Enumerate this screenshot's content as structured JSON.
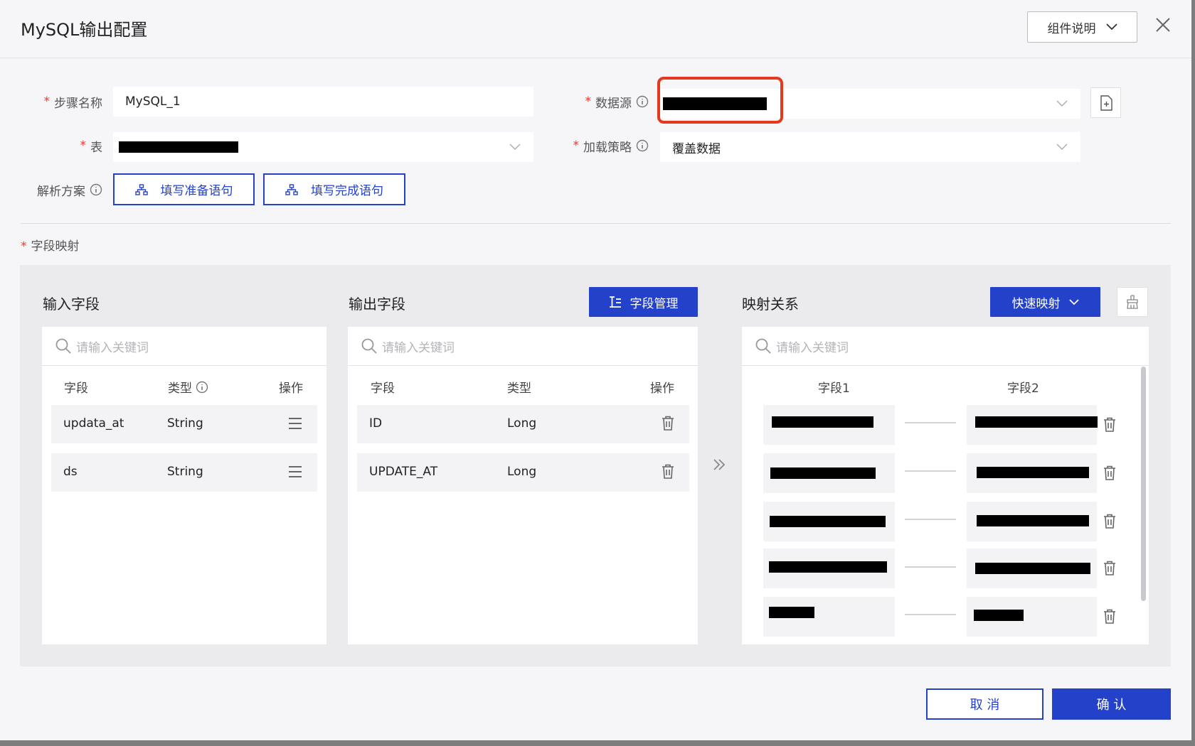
{
  "dialog": {
    "title": "MySQL输出配置",
    "help_label": "组件说明"
  },
  "form": {
    "step_name_label": "步骤名称",
    "step_name_value": "MySQL_1",
    "table_label": "表",
    "datasource_label": "数据源",
    "load_strategy_label": "加载策略",
    "load_strategy_value": "覆盖数据",
    "parse_label": "解析方案",
    "prepare_btn": "填写准备语句",
    "complete_btn": "填写完成语句"
  },
  "mapping": {
    "section_label": "字段映射",
    "input": {
      "title": "输入字段",
      "search_placeholder": "请输入关键词",
      "headers": [
        "字段",
        "类型",
        "操作"
      ],
      "rows": [
        {
          "field": "updata_at",
          "type": "String"
        },
        {
          "field": "ds",
          "type": "String"
        }
      ]
    },
    "output": {
      "title": "输出字段",
      "manage_btn": "字段管理",
      "search_placeholder": "请输入关键词",
      "headers": [
        "字段",
        "类型",
        "操作"
      ],
      "rows": [
        {
          "field": "ID",
          "type": "Long"
        },
        {
          "field": "UPDATE_AT",
          "type": "Long"
        }
      ]
    },
    "relation": {
      "title": "映射关系",
      "quick_btn": "快速映射",
      "search_placeholder": "请输入关键词",
      "headers": [
        "字段1",
        "字段2"
      ]
    }
  },
  "footer": {
    "cancel": "取 消",
    "confirm": "确 认"
  },
  "colors": {
    "primary": "#2341c9",
    "required": "#e8392f",
    "highlight": "#e5391f"
  }
}
